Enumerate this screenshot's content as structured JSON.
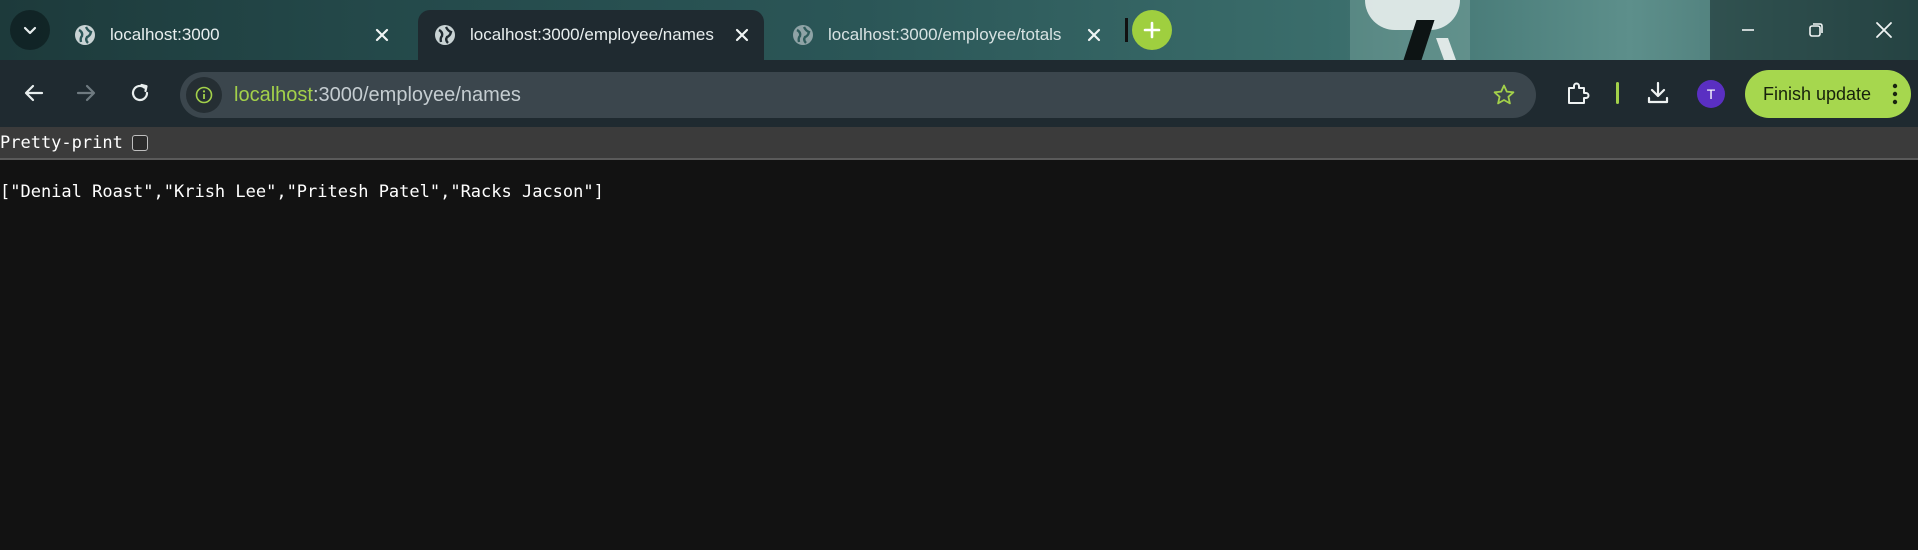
{
  "tabs": [
    {
      "title": "localhost:3000",
      "active": false
    },
    {
      "title": "localhost:3000/employee/names",
      "active": true
    },
    {
      "title": "localhost:3000/employee/totals",
      "active": false
    }
  ],
  "omnibox": {
    "host": "localhost",
    "rest": ":3000/employee/names"
  },
  "profile": {
    "initial": "T"
  },
  "finish_update_label": "Finish update",
  "json_viewer": {
    "pretty_print_label": "Pretty-print",
    "pretty_print_checked": false,
    "raw": "[\"Denial Roast\",\"Krish Lee\",\"Pritesh Patel\",\"Racks Jacson\"]"
  },
  "colors": {
    "accent": "#a6d74e",
    "avatar": "#5a2fc2",
    "toolbar": "#1f2a30",
    "page_bg": "#121212"
  },
  "icons": [
    "chevron-down-icon",
    "globe-icon",
    "close-icon",
    "plus-icon",
    "minimize-icon",
    "restore-icon",
    "back-icon",
    "forward-icon",
    "reload-icon",
    "info-icon",
    "star-icon",
    "extensions-icon",
    "download-icon",
    "kebab-icon"
  ]
}
